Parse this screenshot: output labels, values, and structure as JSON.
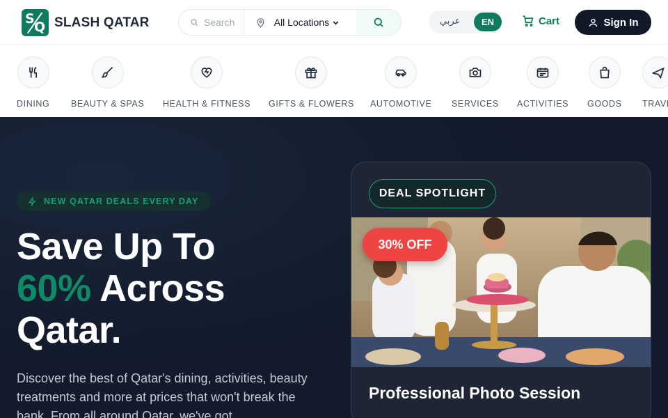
{
  "header": {
    "brand": "SLASH QATAR",
    "search_placeholder": "Search",
    "location_label": "All Locations",
    "lang_ar": "عربي",
    "lang_en": "EN",
    "cart_label": "Cart",
    "signin_label": "Sign In",
    "accent_color": "#0e7b5e"
  },
  "categories": [
    {
      "label": "DINING",
      "icon": "utensils-icon"
    },
    {
      "label": "BEAUTY & SPAS",
      "icon": "brush-icon"
    },
    {
      "label": "HEALTH & FITNESS",
      "icon": "heart-pulse-icon"
    },
    {
      "label": "GIFTS & FLOWERS",
      "icon": "gift-icon"
    },
    {
      "label": "AUTOMOTIVE",
      "icon": "car-icon"
    },
    {
      "label": "SERVICES",
      "icon": "camera-icon"
    },
    {
      "label": "ACTIVITIES",
      "icon": "ticket-icon"
    },
    {
      "label": "GOODS",
      "icon": "shopping-bag-icon"
    },
    {
      "label": "TRAVEL",
      "icon": "plane-icon"
    }
  ],
  "hero": {
    "badge": "NEW QATAR DEALS EVERY DAY",
    "title_line1": "Save Up To",
    "title_accent": "60%",
    "title_line2_rest": " Across",
    "title_line3": "Qatar.",
    "description": "Discover the best of Qatar's dining, activities, beauty treatments and more at prices that won't break the bank. From all around Qatar, we've got"
  },
  "spotlight": {
    "tag": "DEAL SPOTLIGHT",
    "discount": "30% OFF",
    "title": "Professional Photo Session"
  }
}
